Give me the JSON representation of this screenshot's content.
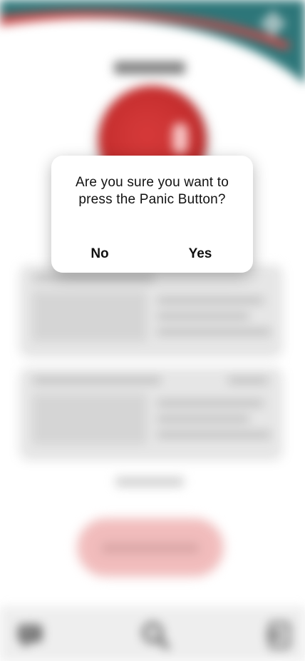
{
  "dialog": {
    "message": "Are you sure you want to press the Panic Button?",
    "no_label": "No",
    "yes_label": "Yes"
  },
  "colors": {
    "header_teal": "#1c6b6e",
    "header_red": "#c73a3a",
    "panic_red": "#c11d1d",
    "dialog_background": "#ffffff"
  },
  "icons": {
    "settings": "gear-icon",
    "nav_left": "message-icon",
    "nav_center": "search-icon",
    "nav_right": "logout-icon"
  }
}
